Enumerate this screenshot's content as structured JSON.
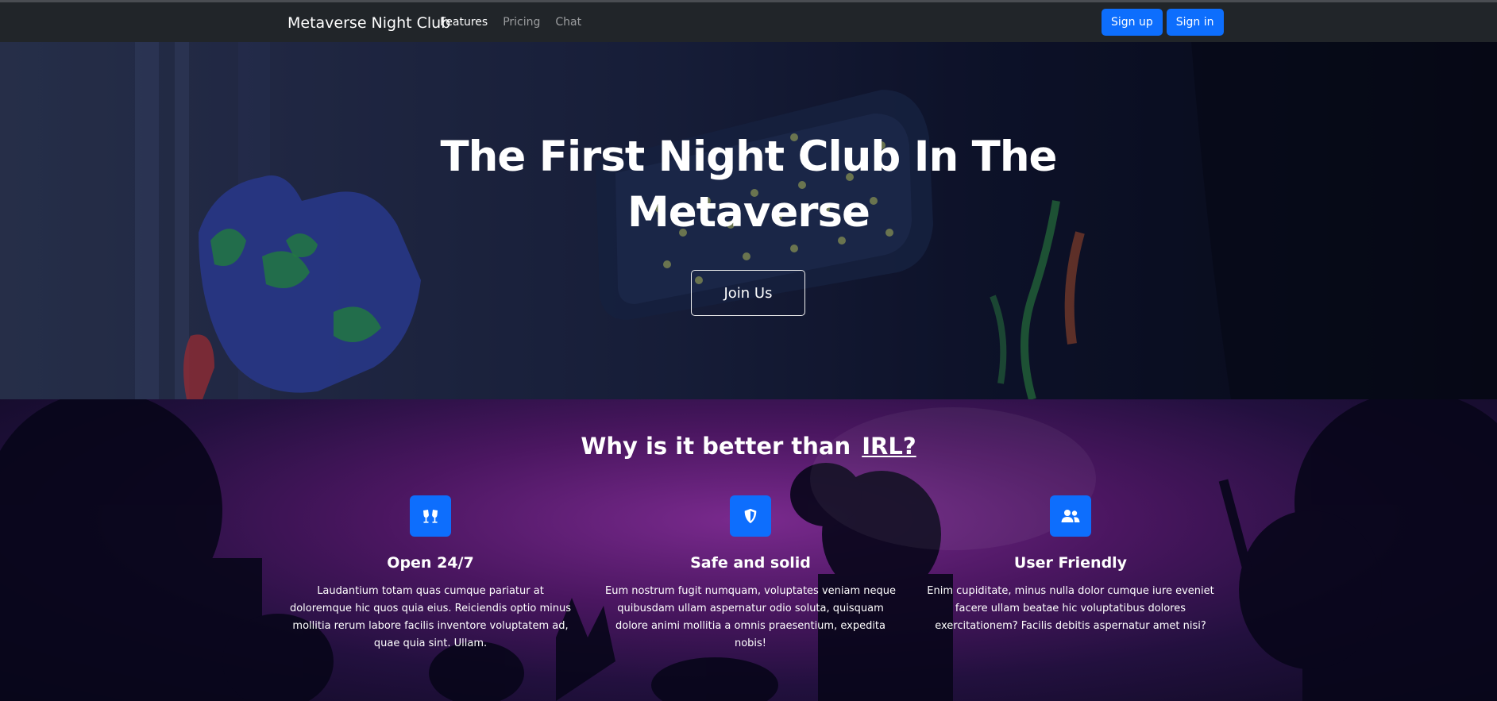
{
  "navbar": {
    "brand": "Metaverse Night Club",
    "links": [
      {
        "label": "Features",
        "active": true
      },
      {
        "label": "Pricing",
        "active": false
      },
      {
        "label": "Chat",
        "active": false
      }
    ],
    "signup_label": "Sign up",
    "signin_label": "Sign in"
  },
  "hero": {
    "title": "The First Night Club In The Metaverse",
    "cta_label": "Join Us"
  },
  "features": {
    "heading_prefix": "Why is it better than",
    "heading_emphasis": "IRL?",
    "items": [
      {
        "icon": "toast-glasses-icon",
        "title": "Open 24/7",
        "text": "Laudantium totam quas cumque pariatur at doloremque hic quos quia eius. Reiciendis optio minus mollitia rerum labore facilis inventore voluptatem ad, quae quia sint. Ullam."
      },
      {
        "icon": "shield-icon",
        "title": "Safe and solid",
        "text": "Eum nostrum fugit numquam, voluptates veniam neque quibusdam ullam aspernatur odio soluta, quisquam dolore animi mollitia a omnis praesentium, expedita nobis!"
      },
      {
        "icon": "users-icon",
        "title": "User Friendly",
        "text": "Enim cupiditate, minus nulla dolor cumque iure eveniet facere ullam beatae hic voluptatibus dolores exercitationem? Facilis debitis aspernatur amet nisi?"
      }
    ]
  },
  "colors": {
    "primary": "#0d6efd",
    "navbar_bg": "#212529"
  }
}
